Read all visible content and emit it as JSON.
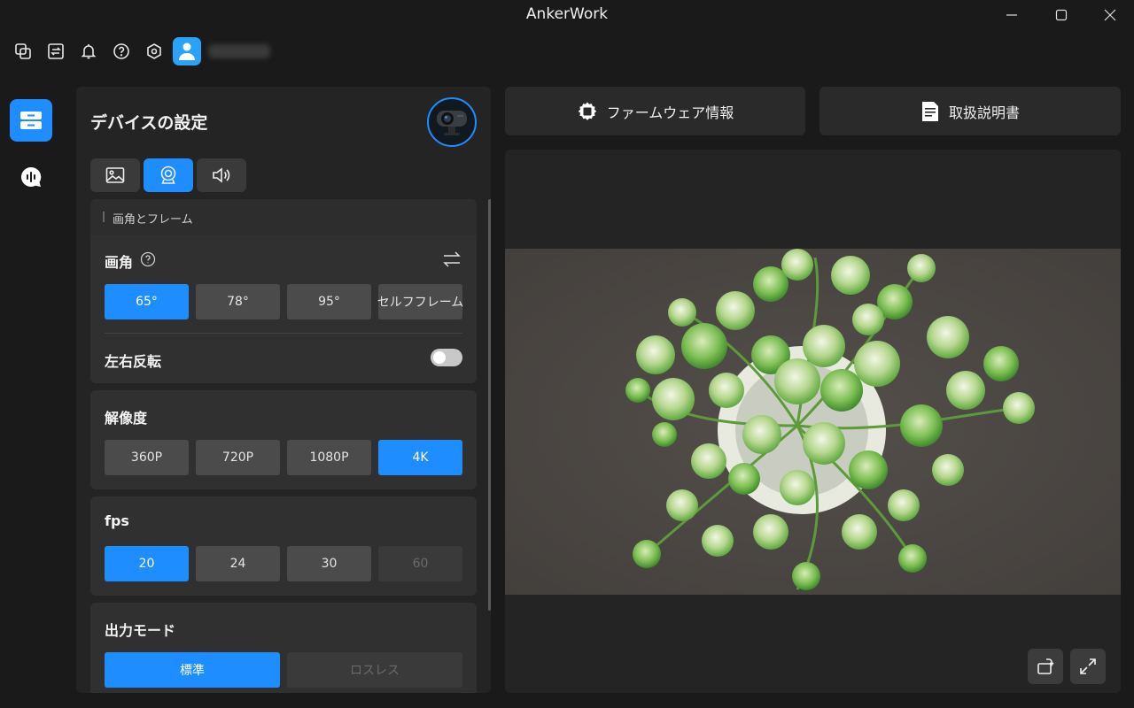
{
  "app": {
    "title": "AnkerWork"
  },
  "window": {
    "minimize": "—",
    "maximize": "▢",
    "close": "✕"
  },
  "user": {
    "name": ""
  },
  "settings": {
    "title": "デバイスの設定",
    "section_title": "画角とフレーム",
    "fov": {
      "label": "画角",
      "options": [
        "65°",
        "78°",
        "95°",
        "セルフフレーム"
      ],
      "selected": "65°"
    },
    "mirror": {
      "label": "左右反転",
      "enabled": false
    },
    "resolution": {
      "label": "解像度",
      "options": [
        "360P",
        "720P",
        "1080P",
        "4K"
      ],
      "selected": "4K"
    },
    "fps": {
      "label": "fps",
      "options": [
        "20",
        "24",
        "30",
        "60"
      ],
      "selected": "20",
      "disabled": [
        "60"
      ]
    },
    "output_mode": {
      "label": "出力モード",
      "options": [
        "標準",
        "ロスレス"
      ],
      "selected": "標準",
      "disabled": [
        "ロスレス"
      ]
    }
  },
  "right": {
    "firmware_label": "ファームウェア情報",
    "manual_label": "取扱説明書"
  },
  "colors": {
    "accent": "#1e8dff",
    "panel": "#242424",
    "card": "#303030",
    "option": "#4b4b4b"
  }
}
